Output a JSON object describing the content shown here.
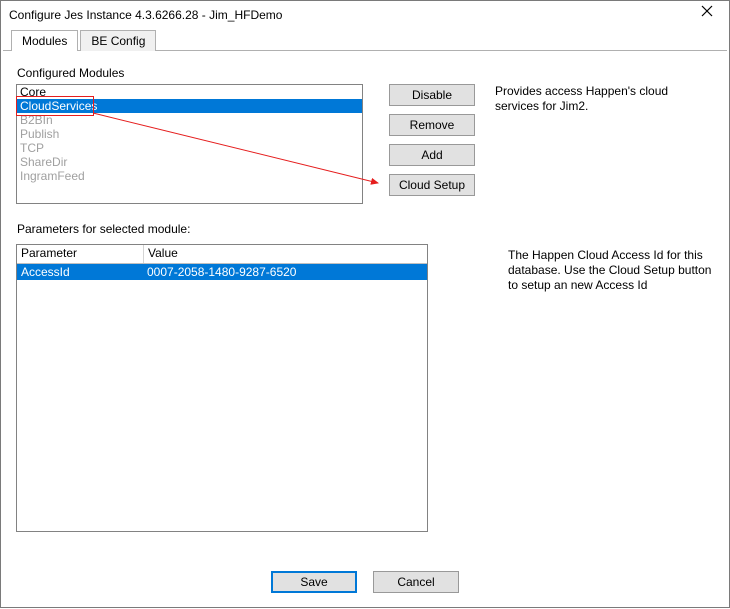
{
  "window": {
    "title": "Configure Jes Instance 4.3.6266.28 - Jim_HFDemo"
  },
  "tabs": [
    {
      "label": "Modules",
      "active": true
    },
    {
      "label": "BE Config",
      "active": false
    }
  ],
  "modules": {
    "heading": "Configured Modules",
    "items": [
      {
        "name": "Core",
        "enabled": true
      },
      {
        "name": "CloudServices",
        "enabled": true,
        "selected": true
      },
      {
        "name": "B2BIn",
        "enabled": false
      },
      {
        "name": "Publish",
        "enabled": false
      },
      {
        "name": "TCP",
        "enabled": false
      },
      {
        "name": "ShareDir",
        "enabled": false
      },
      {
        "name": "IngramFeed",
        "enabled": false
      }
    ],
    "description": "Provides access Happen's cloud services for Jim2."
  },
  "buttons": {
    "disable": "Disable",
    "remove": "Remove",
    "add": "Add",
    "cloud_setup": "Cloud Setup",
    "save": "Save",
    "cancel": "Cancel"
  },
  "params": {
    "heading": "Parameters for selected module:",
    "columns": {
      "param": "Parameter",
      "value": "Value"
    },
    "rows": [
      {
        "param": "AccessId",
        "value": "0007-2058-1480-9287-6520",
        "selected": true
      }
    ],
    "description": "The Happen Cloud Access Id for this database.  Use the Cloud Setup button to setup an new Access Id"
  }
}
